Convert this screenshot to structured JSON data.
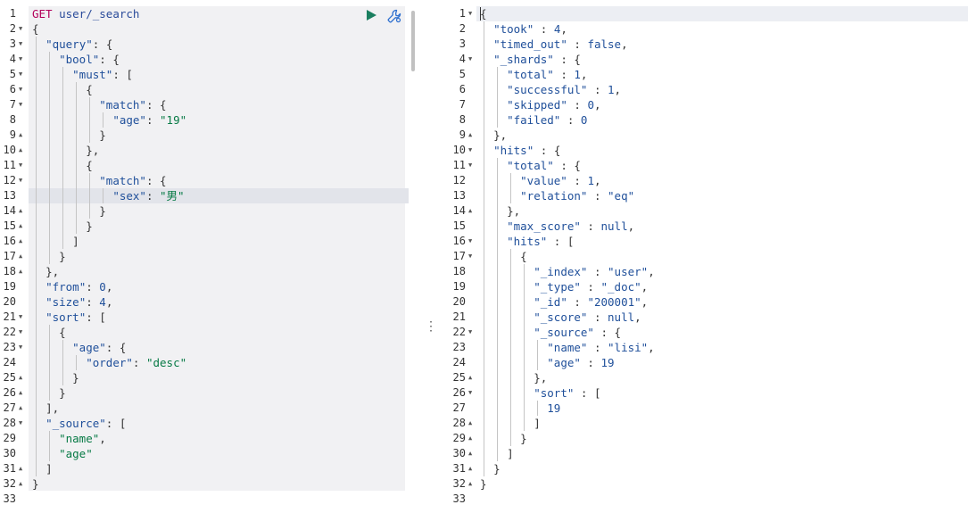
{
  "request_panel": {
    "first_line_method": "GET",
    "first_line_path": "user/_search",
    "run_button_label": "Run",
    "settings_button_label": "Request options",
    "lines": [
      "GET user/_search",
      "{",
      "  \"query\": {",
      "    \"bool\": {",
      "      \"must\": [",
      "        {",
      "          \"match\": {",
      "            \"age\": \"19\"",
      "          }",
      "        },",
      "        {",
      "          \"match\": {",
      "            \"sex\": \"男\"",
      "          }",
      "        }",
      "      ]",
      "    }",
      "  },",
      "  \"from\": 0,",
      "  \"size\": 4,",
      "  \"sort\": [",
      "    {",
      "      \"age\": {",
      "        \"order\": \"desc\"",
      "      }",
      "    }",
      "  ],",
      "  \"_source\": [",
      "    \"name\",",
      "    \"age\"",
      "  ]",
      "}",
      ""
    ],
    "line_numbers": [
      "1",
      "2",
      "3",
      "4",
      "5",
      "6",
      "7",
      "8",
      "9",
      "10",
      "11",
      "12",
      "13",
      "14",
      "15",
      "16",
      "17",
      "18",
      "19",
      "20",
      "21",
      "22",
      "23",
      "24",
      "25",
      "26",
      "27",
      "28",
      "29",
      "30",
      "31",
      "32",
      "33"
    ],
    "active_line": 13
  },
  "response_panel": {
    "lines": [
      "{",
      "  \"took\" : 4,",
      "  \"timed_out\" : false,",
      "  \"_shards\" : {",
      "    \"total\" : 1,",
      "    \"successful\" : 1,",
      "    \"skipped\" : 0,",
      "    \"failed\" : 0",
      "  },",
      "  \"hits\" : {",
      "    \"total\" : {",
      "      \"value\" : 1,",
      "      \"relation\" : \"eq\"",
      "    },",
      "    \"max_score\" : null,",
      "    \"hits\" : [",
      "      {",
      "        \"_index\" : \"user\",",
      "        \"_type\" : \"_doc\",",
      "        \"_id\" : \"200001\",",
      "        \"_score\" : null,",
      "        \"_source\" : {",
      "          \"name\" : \"lisi\",",
      "          \"age\" : 19",
      "        },",
      "        \"sort\" : [",
      "          19",
      "        ]",
      "      }",
      "    ]",
      "  }",
      "}",
      ""
    ],
    "line_numbers": [
      "1",
      "2",
      "3",
      "4",
      "5",
      "6",
      "7",
      "8",
      "9",
      "10",
      "11",
      "12",
      "13",
      "14",
      "15",
      "16",
      "17",
      "18",
      "19",
      "20",
      "21",
      "22",
      "23",
      "24",
      "25",
      "26",
      "27",
      "28",
      "29",
      "30",
      "31",
      "32",
      "33"
    ],
    "active_line": 1
  },
  "icons": {
    "run": "play-icon",
    "settings": "wrench-icon",
    "divider": "vertical-ellipsis-icon",
    "fold_open": "fold-arrow-down-icon",
    "fold_close": "fold-arrow-up-icon"
  },
  "colors": {
    "method": "#b3005a",
    "key": "#1f4f9a",
    "string": "#077a45",
    "run_button": "#1a7f5f",
    "settings_icon": "#2d6fcf"
  }
}
